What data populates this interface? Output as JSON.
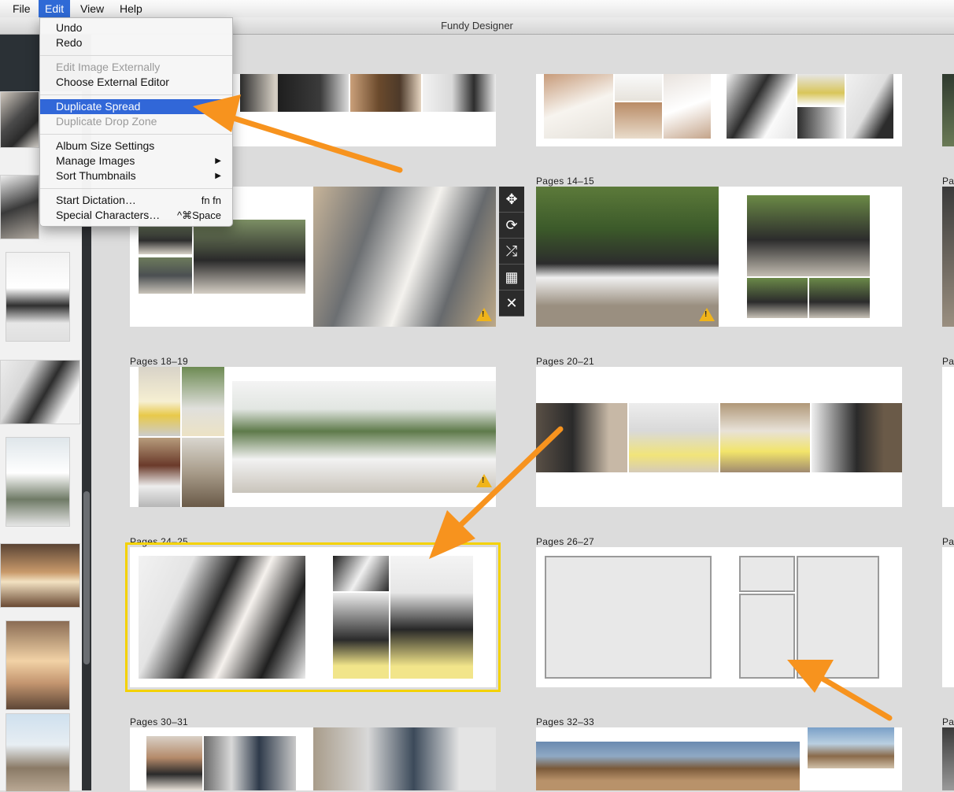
{
  "menubar": {
    "items": [
      "File",
      "Edit",
      "View",
      "Help"
    ],
    "active": "Edit"
  },
  "window": {
    "title": "Fundy Designer"
  },
  "edit_menu": {
    "undo": "Undo",
    "redo": "Redo",
    "edit_external": "Edit Image Externally",
    "choose_editor": "Choose External Editor",
    "duplicate_spread": "Duplicate Spread",
    "duplicate_drop_zone": "Duplicate Drop Zone",
    "album_size": "Album Size Settings",
    "manage_images": "Manage Images",
    "sort_thumbnails": "Sort Thumbnails",
    "start_dictation": "Start Dictation…",
    "start_dictation_shortcut": "fn fn",
    "special_chars": "Special Characters…",
    "special_chars_shortcut": "^⌘Space"
  },
  "spreads": {
    "s14": "Pages 14–15",
    "s18": "Pages 18–19",
    "s20": "Pages 20–21",
    "s24": "Pages 24–25",
    "s26": "Pages 26–27",
    "s30": "Pages 30–31",
    "s32": "Pages 32–33",
    "partial_prefix": "Pag",
    "partial_prefix_cut": "Pa"
  },
  "toolbar_icons": [
    "move-icon",
    "rotate-icon",
    "shuffle-icon",
    "grid-icon",
    "close-icon"
  ],
  "colors": {
    "accent_blue": "#3167d8",
    "selection_yellow": "#f4d200",
    "arrow_orange": "#f7931e",
    "warning_yellow": "#f0b41a"
  }
}
